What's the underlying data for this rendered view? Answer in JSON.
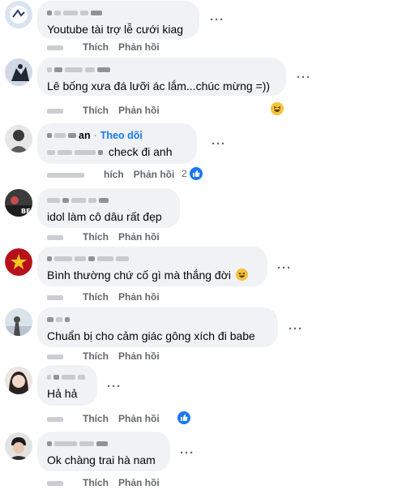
{
  "comments": [
    {
      "name_suffix": "",
      "text": "Youtube tài trợ lễ cưới kiag",
      "actions": {
        "like": "Thích",
        "reply": "Phản hồi"
      },
      "reaction_count": ""
    },
    {
      "name_suffix": "",
      "text": "Lê bống xưa đá lưỡi ác lắm...chúc mừng =))",
      "actions": {
        "like": "Thích",
        "reply": "Phản hồi"
      },
      "reaction_count": ""
    },
    {
      "name_suffix": "an",
      "follow": "Theo dõi",
      "text": "check đi anh",
      "actions": {
        "like": "hích",
        "reply": "Phản hồi"
      },
      "reaction_count": "2"
    },
    {
      "name_suffix": "",
      "text": "idol làm cô dâu rất đẹp",
      "actions": {
        "like": "Thích",
        "reply": "Phản hồi"
      },
      "reaction_count": ""
    },
    {
      "name_suffix": "",
      "text": "Bình thường chứ cố gì mà thắng đời",
      "actions": {
        "like": "Thích",
        "reply": "Phản hồi"
      },
      "reaction_count": ""
    },
    {
      "name_suffix": "",
      "text": "Chuẩn bị cho cảm giác gông xích đi babe",
      "actions": {
        "like": "Thích",
        "reply": "Phản hồi"
      },
      "reaction_count": ""
    },
    {
      "name_suffix": "",
      "text": "Hả hả",
      "actions": {
        "like": "Thích",
        "reply": "Phản hồi"
      },
      "reaction_count": ""
    },
    {
      "name_suffix": "",
      "text": "Ok chàng trai hà nam",
      "actions": {
        "like": "Thích",
        "reply": "Phản hồi"
      },
      "reaction_count": ""
    }
  ],
  "colors": {
    "bubble": "#f0f2f5",
    "link": "#1877f2",
    "muted": "#65676b"
  },
  "icons": {
    "more": "more-options-icon",
    "like_reaction": "like-reaction-icon",
    "haha_reaction": "haha-reaction-icon"
  }
}
